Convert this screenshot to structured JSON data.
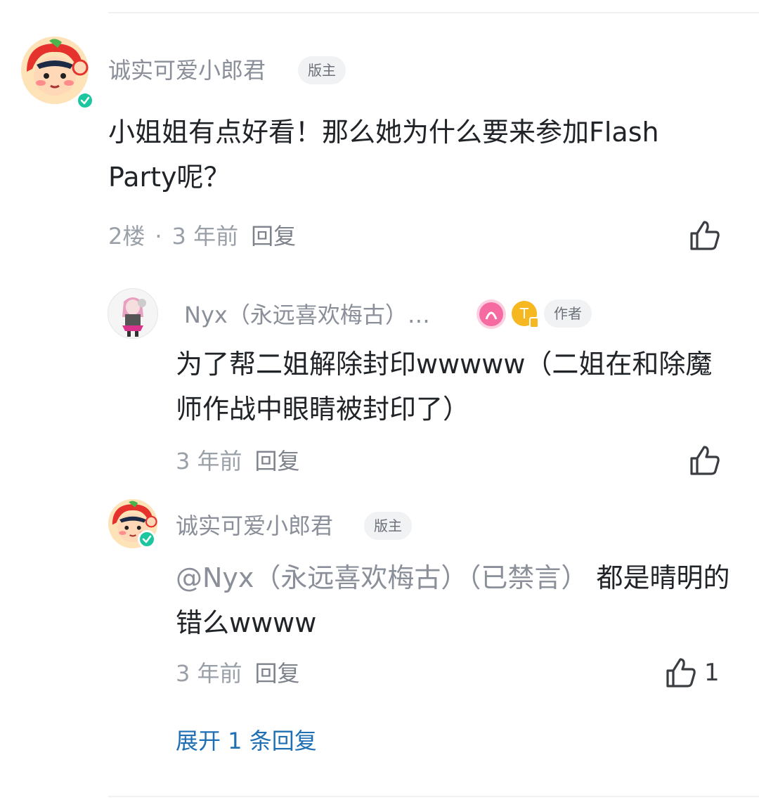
{
  "comment": {
    "username": "诚实可爱小郎君",
    "badge": "版主",
    "text": "小姐姐有点好看！那么她为什么要来参加Flash Party呢？",
    "floor": "2楼",
    "time": "3 年前",
    "reply_label": "回复",
    "like_count": ""
  },
  "replies": [
    {
      "username": "Nyx（永远喜欢梅古）…",
      "badge": "作者",
      "text": "为了帮二姐解除封印wwwww（二姐在和除魔师作战中眼睛被封印了）",
      "time": "3 年前",
      "reply_label": "回复",
      "like_count": ""
    },
    {
      "username": "诚实可爱小郎君",
      "badge": "版主",
      "mention": "@Nyx（永远喜欢梅古）（已禁言）",
      "text": " 都是晴明的错么wwww",
      "time": "3 年前",
      "reply_label": "回复",
      "like_count": "1"
    }
  ],
  "expand_label": "展开 1 条回复",
  "icons": {
    "like": "thumbs-up-icon",
    "verified": "checkmark-icon"
  },
  "colors": {
    "link": "#1e6fb4",
    "verified": "#1cc7a0",
    "secondary_text": "#8a8f99"
  }
}
